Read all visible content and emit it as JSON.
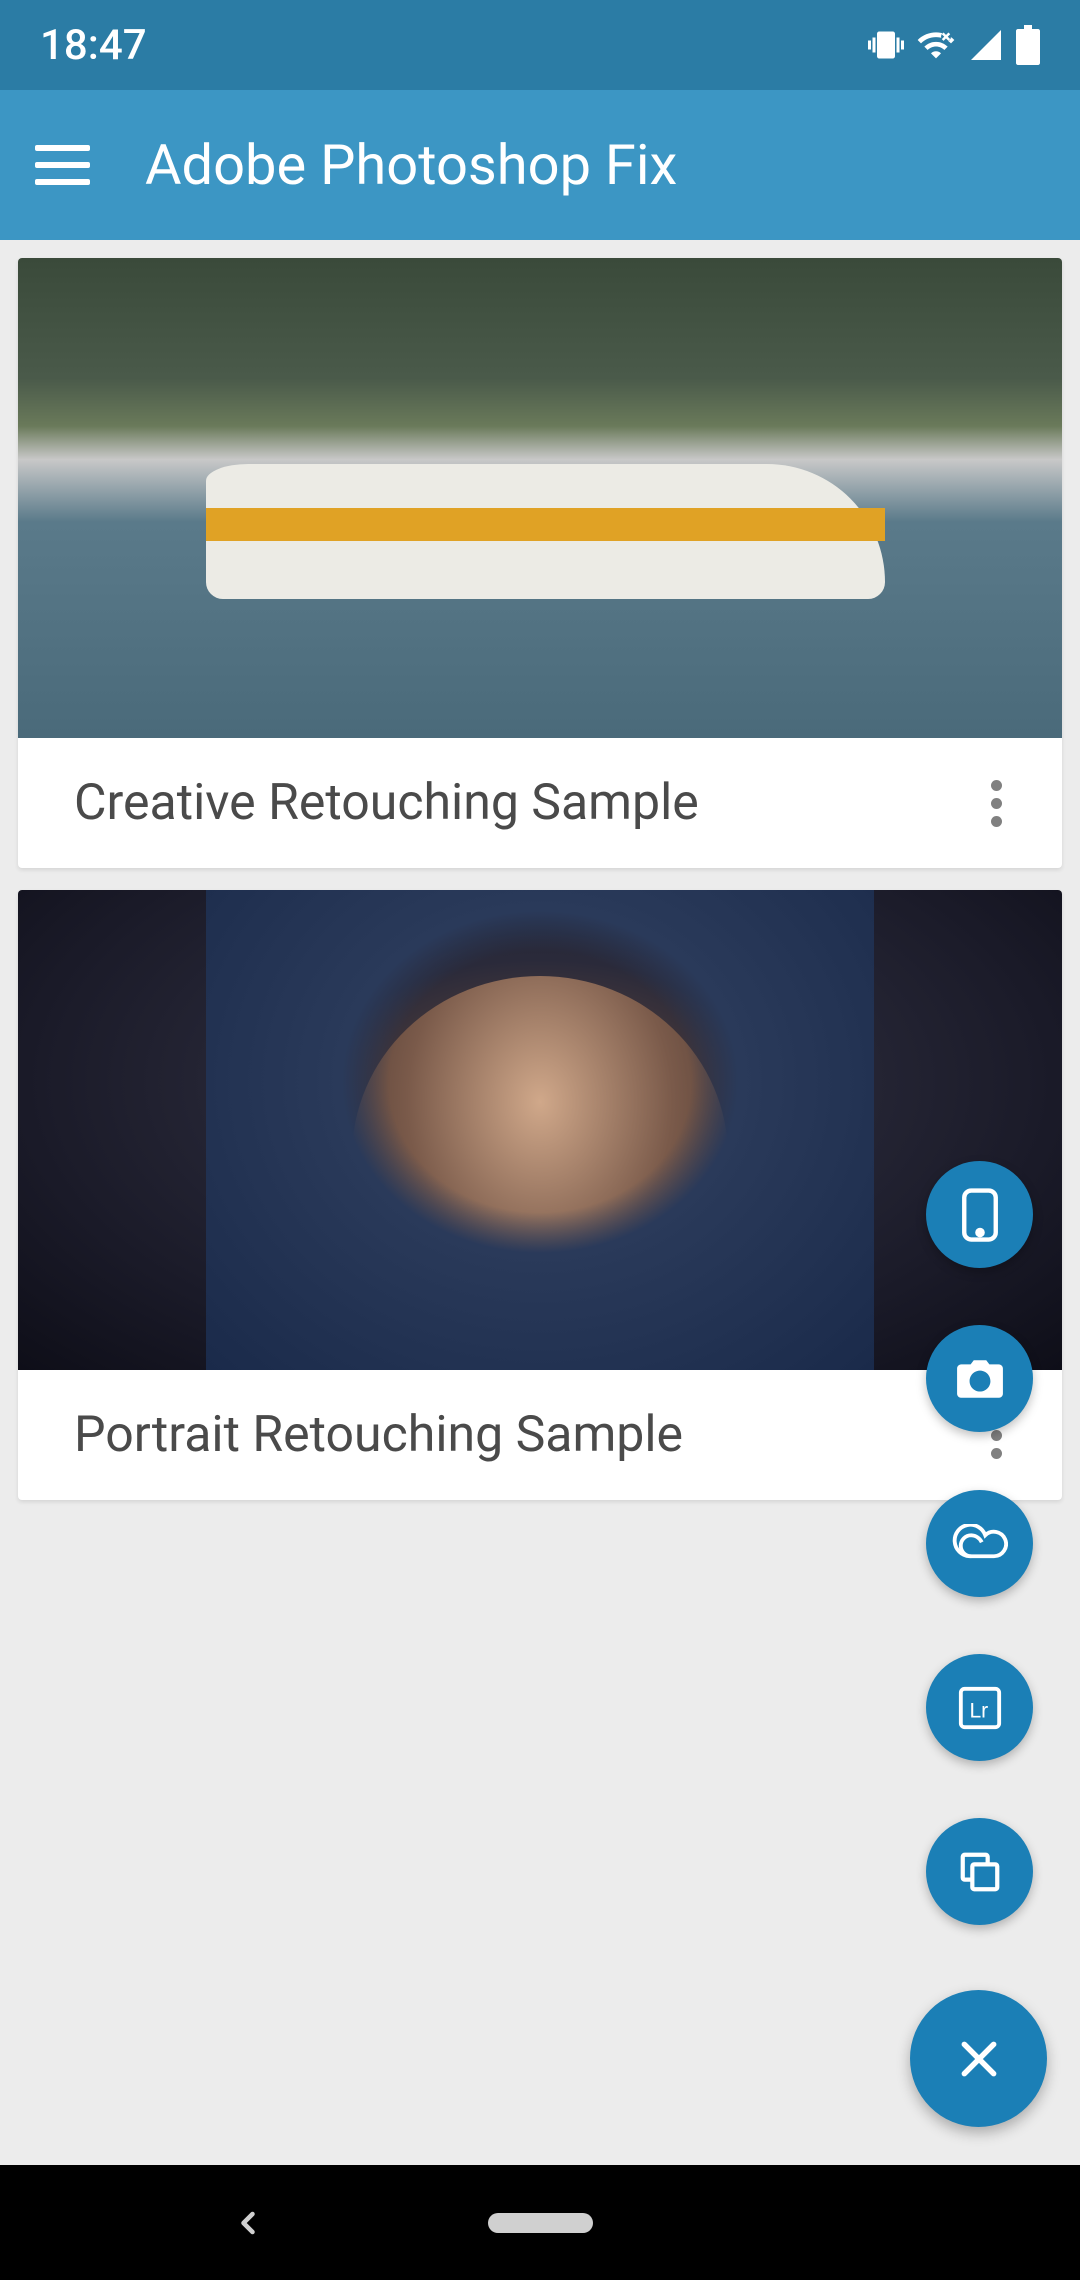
{
  "status_bar": {
    "time": "18:47"
  },
  "app_bar": {
    "title": "Adobe Photoshop Fix"
  },
  "projects": [
    {
      "title": "Creative Retouching Sample",
      "image_desc": "seaplane"
    },
    {
      "title": "Portrait Retouching Sample",
      "image_desc": "portrait"
    }
  ],
  "fab_icons": {
    "phone": "phone-icon",
    "camera": "camera-icon",
    "cloud": "creative-cloud-icon",
    "lightroom": "lightroom-icon",
    "files": "files-icon",
    "close": "close-icon"
  }
}
